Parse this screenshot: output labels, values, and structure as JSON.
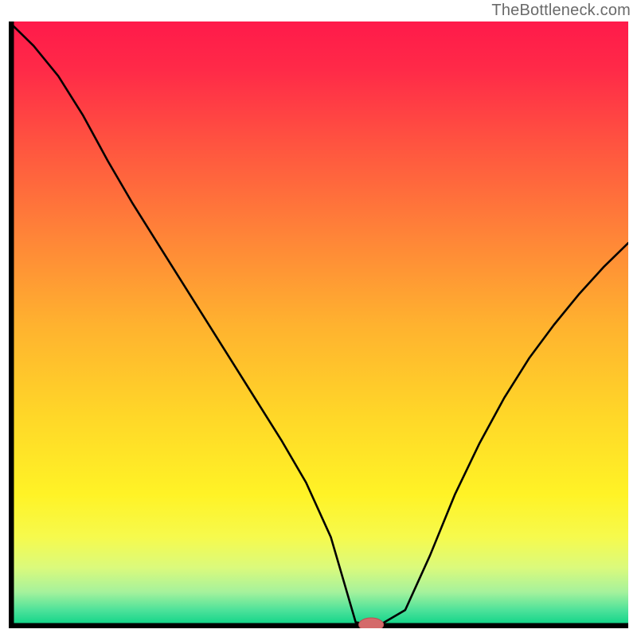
{
  "attribution": "TheBottleneck.com",
  "colors": {
    "gradient_stops": [
      {
        "offset": 0.0,
        "color": "#ff1a4a"
      },
      {
        "offset": 0.08,
        "color": "#ff2a48"
      },
      {
        "offset": 0.2,
        "color": "#ff5340"
      },
      {
        "offset": 0.35,
        "color": "#ff8338"
      },
      {
        "offset": 0.5,
        "color": "#ffb22f"
      },
      {
        "offset": 0.65,
        "color": "#ffd728"
      },
      {
        "offset": 0.78,
        "color": "#fff326"
      },
      {
        "offset": 0.85,
        "color": "#f6fa4d"
      },
      {
        "offset": 0.9,
        "color": "#dbfa7c"
      },
      {
        "offset": 0.94,
        "color": "#a6f29c"
      },
      {
        "offset": 0.97,
        "color": "#4ee29a"
      },
      {
        "offset": 1.0,
        "color": "#00d184"
      }
    ],
    "axis": "#000000",
    "curve": "#000000",
    "marker_fill": "#d46a6a",
    "marker_stroke": "#b94f55"
  },
  "chart_data": {
    "type": "line",
    "title": "",
    "xlabel": "",
    "ylabel": "",
    "xlim": [
      0,
      100
    ],
    "ylim": [
      0,
      100
    ],
    "x": [
      0,
      4,
      8,
      12,
      16,
      20,
      24,
      28,
      32,
      36,
      40,
      44,
      48,
      52,
      54,
      56,
      58,
      60,
      64,
      68,
      72,
      76,
      80,
      84,
      88,
      92,
      96,
      100
    ],
    "values": [
      100,
      96,
      91,
      84.5,
      77,
      70,
      63.5,
      57,
      50.5,
      44,
      37.5,
      31,
      24,
      15,
      8,
      1,
      0.6,
      0.6,
      3,
      12,
      22,
      30.5,
      38,
      44.5,
      50,
      55,
      59.5,
      63.5
    ],
    "marker": {
      "x": 58.5,
      "y": 0.6,
      "rx": 2.0,
      "ry": 1.1
    },
    "annotations": []
  }
}
